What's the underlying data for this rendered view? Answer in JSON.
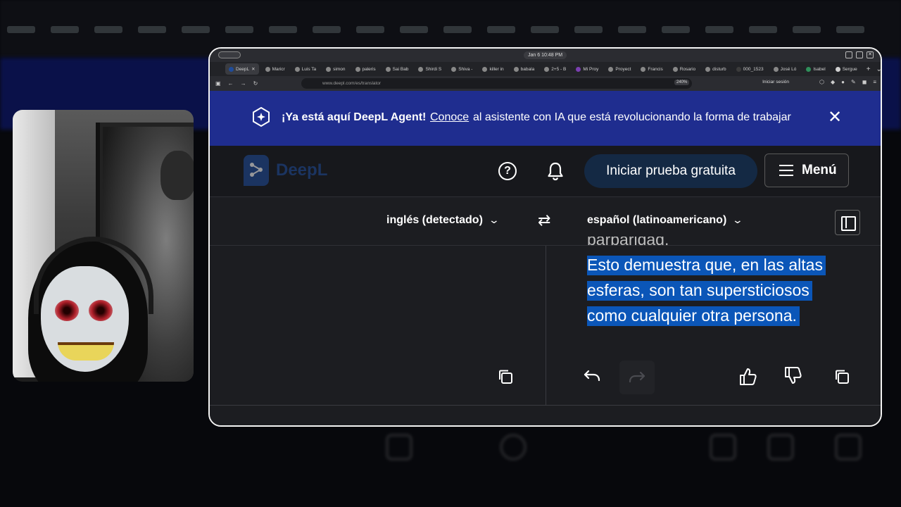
{
  "titlebar": {
    "clock": "Jan 6  10:48 PM"
  },
  "tabs": [
    {
      "label": "DeepL",
      "active": true
    },
    {
      "label": "Maricr"
    },
    {
      "label": "Luis Ta"
    },
    {
      "label": "simon"
    },
    {
      "label": "paleris"
    },
    {
      "label": "Sai Bab"
    },
    {
      "label": "Shirdi S"
    },
    {
      "label": "Shiva -"
    },
    {
      "label": "killer in"
    },
    {
      "label": "babala"
    },
    {
      "label": "2+5 - B"
    },
    {
      "label": "Mi Proy"
    },
    {
      "label": "Proyect"
    },
    {
      "label": "Francis"
    },
    {
      "label": "Rosario"
    },
    {
      "label": "disturb"
    },
    {
      "label": "000_1523"
    },
    {
      "label": "José Ló"
    },
    {
      "label": "Isabel"
    },
    {
      "label": "Sergue"
    }
  ],
  "navbar": {
    "url": "www.deepl.com/es/translator",
    "zoom": "240%",
    "signin": "Iniciar sesión"
  },
  "banner": {
    "bold": "¡Ya está aquí DeepL Agent!",
    "link": "Conoce",
    "text": "al asistente con IA que está revolucionando la forma de trabajar",
    "close": "✕"
  },
  "header": {
    "logo": "DeepL",
    "help": "?",
    "trial_button": "Iniciar prueba gratuita",
    "menu_button": "Menú"
  },
  "languages": {
    "source": "inglés (detectado)",
    "target": "español (latinoamericano)",
    "chevron": "⌄",
    "swap": "⇄"
  },
  "translation": {
    "cut_line": "barbaridad.",
    "highlighted_lines": [
      "Esto demuestra que, en las altas",
      "esferas, son tan supersticiosos",
      "como cualquier otra persona."
    ]
  }
}
